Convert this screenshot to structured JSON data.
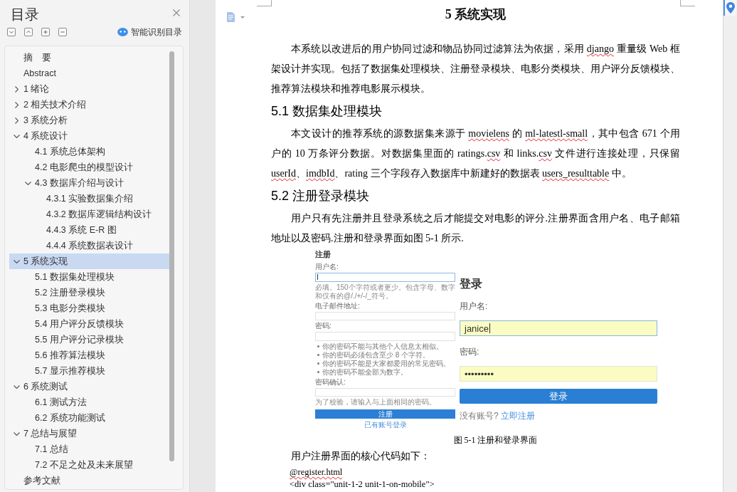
{
  "sidebar": {
    "title": "目录",
    "smart_toc": "智能识别目录",
    "items": [
      {
        "label": "摘　要",
        "selected": false
      },
      {
        "label": "Abstract",
        "selected": false
      },
      {
        "label": "1 绪论",
        "expanded": false,
        "selected": false
      },
      {
        "label": "2 相关技术介绍",
        "expanded": false,
        "selected": false
      },
      {
        "label": "3 系统分析",
        "expanded": false,
        "selected": false
      },
      {
        "label": "4 系统设计",
        "expanded": true,
        "selected": false,
        "children": [
          {
            "label": "4.1 系统总体架构",
            "selected": false
          },
          {
            "label": "4.2 电影爬虫的模型设计",
            "selected": false
          },
          {
            "label": "4.3 数据库介绍与设计",
            "expanded": true,
            "selected": false,
            "children": [
              {
                "label": "4.3.1 实验数据集介绍",
                "selected": false
              },
              {
                "label": "4.3.2 数据库逻辑结构设计",
                "selected": false
              },
              {
                "label": "4.4.3 系统 E-R 图",
                "selected": false
              },
              {
                "label": "4.4.4 系统数据表设计",
                "selected": false
              }
            ]
          }
        ]
      },
      {
        "label": "5 系统实现",
        "expanded": true,
        "selected": true,
        "children": [
          {
            "label": "5.1 数据集处理模块",
            "selected": false
          },
          {
            "label": "5.2 注册登录模块",
            "selected": false
          },
          {
            "label": "5.3 电影分类模块",
            "selected": false
          },
          {
            "label": "5.4 用户评分反馈模块",
            "selected": false
          },
          {
            "label": "5.5 用户评分记录模块",
            "selected": false
          },
          {
            "label": "5.6 推荐算法模块",
            "selected": false
          },
          {
            "label": "5.7 显示推荐模块",
            "selected": false
          }
        ]
      },
      {
        "label": "6 系统测试",
        "expanded": true,
        "selected": false,
        "children": [
          {
            "label": "6.1 测试方法",
            "selected": false
          },
          {
            "label": "6.2 系统功能测试",
            "selected": false
          }
        ]
      },
      {
        "label": "7 总结与展望",
        "expanded": true,
        "selected": false,
        "children": [
          {
            "label": "7.1 总结",
            "selected": false
          },
          {
            "label": "7.2 不足之处及未来展望",
            "selected": false
          }
        ]
      },
      {
        "label": "参考文献",
        "selected": false
      }
    ]
  },
  "document": {
    "title": "5 系统实现",
    "blocks": [
      {
        "kind": "paragraph",
        "segments": [
          {
            "text": "本系统以改进后的用户协同过滤和物品协同过滤算法为依据，采用 ",
            "misspelled": false
          },
          {
            "text": "django",
            "misspelled": true
          },
          {
            "text": " 重量级 Web 框架设计并实现。包括了数据集处理模块、注册登录模块、电影分类模块、用户评分反馈模块、推荐算法模块和推荐电影展示模块。",
            "misspelled": false
          }
        ]
      },
      {
        "kind": "heading",
        "text": "5.1 数据集处理模块"
      },
      {
        "kind": "paragraph",
        "segments": [
          {
            "text": "本文设计的推荐系统的源数据集来源于 ",
            "misspelled": false
          },
          {
            "text": "movielens",
            "misspelled": true
          },
          {
            "text": " 的 ",
            "misspelled": false
          },
          {
            "text": "ml-latestl-small",
            "misspelled": true
          },
          {
            "text": "，其中包含 671 个用户的 10 万条评分数据。对数据集里面的 ratings.",
            "misspelled": false
          },
          {
            "text": "csv",
            "misspelled": true
          },
          {
            "text": " 和 links.",
            "misspelled": false
          },
          {
            "text": "csv",
            "misspelled": true
          },
          {
            "text": " 文件进行连接处理，只保留 ",
            "misspelled": false
          },
          {
            "text": "userId",
            "misspelled": true
          },
          {
            "text": "、",
            "misspelled": false
          },
          {
            "text": "imdbId",
            "misspelled": true
          },
          {
            "text": "、rating 三个字段存入数据库中新建好的数据表 ",
            "misspelled": false
          },
          {
            "text": "users_resulttable",
            "misspelled": true
          },
          {
            "text": " 中。",
            "misspelled": false
          }
        ]
      },
      {
        "kind": "heading",
        "text": "5.2 注册登录模块"
      },
      {
        "kind": "paragraph",
        "segments": [
          {
            "text": "用户只有先注册并且登录系统之后才能提交对电影的评分.注册界面含用户名、电子邮箱地址以及密码.注册和登录界面如图 5-1 所示.",
            "misspelled": false
          }
        ]
      },
      {
        "kind": "figure",
        "register_form": {
          "title": "注册",
          "fields": [
            {
              "label": "用户名:",
              "focused": true,
              "help": "必填。150个字符或者更少。包含字母、数字和仅有的@/./+/-/_符号。"
            },
            {
              "label": "电子邮件地址:",
              "focused": false
            },
            {
              "label": "密码:",
              "focused": false,
              "rules": [
                "你的密码不能与其他个人信息太相似。",
                "你的密码必须包含至少 8 个字符。",
                "你的密码不能是大家都爱用的常见密码。",
                "你的密码不能全部为数字。"
              ]
            },
            {
              "label": "密码确认:",
              "focused": false,
              "help": "为了校验，请输入与上面相同的密码。"
            }
          ],
          "button": "注册",
          "link": "已有账号登录"
        },
        "login_form": {
          "title": "登录",
          "fields": [
            {
              "label": "用户名:",
              "value": "janice",
              "focused": true,
              "autofilled": true
            },
            {
              "label": "密码:",
              "value": "•••••••••",
              "focused": false,
              "autofilled": true
            }
          ],
          "button": "登录",
          "prompt": "没有账号?",
          "link": "立即注册"
        },
        "caption": "图 5-1 注册和登录界面"
      },
      {
        "kind": "paragraph",
        "segments": [
          {
            "text": "用户注册界面的核心代码如下：",
            "misspelled": false
          }
        ]
      },
      {
        "kind": "code",
        "segments": [
          {
            "text": "@register.html",
            "misspelled": true
          }
        ]
      },
      {
        "kind": "code",
        "segments": [
          {
            "text": "<div class=\"unit-1-2 unit-1-on-mobile\">",
            "misspelled": false
          }
        ]
      }
    ]
  }
}
